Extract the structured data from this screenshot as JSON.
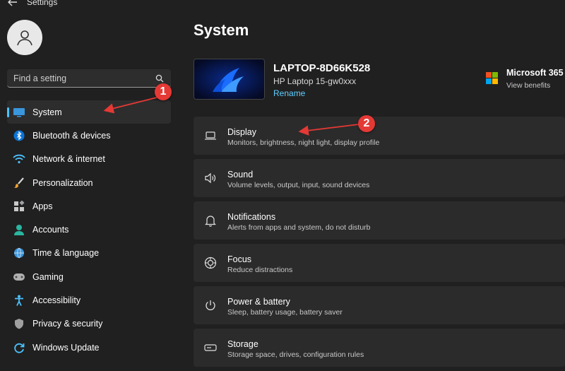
{
  "app": {
    "title": "Settings"
  },
  "search": {
    "placeholder": "Find a setting"
  },
  "sidebar": {
    "items": [
      {
        "label": "System",
        "icon": "monitor-icon",
        "selected": true
      },
      {
        "label": "Bluetooth & devices",
        "icon": "bluetooth-icon"
      },
      {
        "label": "Network & internet",
        "icon": "wifi-icon"
      },
      {
        "label": "Personalization",
        "icon": "brush-icon"
      },
      {
        "label": "Apps",
        "icon": "apps-icon"
      },
      {
        "label": "Accounts",
        "icon": "person-icon"
      },
      {
        "label": "Time & language",
        "icon": "globe-clock-icon"
      },
      {
        "label": "Gaming",
        "icon": "gamepad-icon"
      },
      {
        "label": "Accessibility",
        "icon": "accessibility-icon"
      },
      {
        "label": "Privacy & security",
        "icon": "shield-icon"
      },
      {
        "label": "Windows Update",
        "icon": "update-icon"
      }
    ]
  },
  "main": {
    "title": "System",
    "device": {
      "name": "LAPTOP-8D66K528",
      "model": "HP Laptop 15-gw0xxx",
      "rename_label": "Rename"
    },
    "microsoft365": {
      "title": "Microsoft 365",
      "subtitle": "View benefits"
    },
    "cards": [
      {
        "title": "Display",
        "subtitle": "Monitors, brightness, night light, display profile",
        "icon": "laptop-icon"
      },
      {
        "title": "Sound",
        "subtitle": "Volume levels, output, input, sound devices",
        "icon": "speaker-icon"
      },
      {
        "title": "Notifications",
        "subtitle": "Alerts from apps and system, do not disturb",
        "icon": "bell-icon"
      },
      {
        "title": "Focus",
        "subtitle": "Reduce distractions",
        "icon": "focus-icon"
      },
      {
        "title": "Power & battery",
        "subtitle": "Sleep, battery usage, battery saver",
        "icon": "power-icon"
      },
      {
        "title": "Storage",
        "subtitle": "Storage space, drives, configuration rules",
        "icon": "storage-icon"
      }
    ]
  },
  "annotations": {
    "callout_1": "1",
    "callout_2": "2"
  },
  "colors": {
    "accent": "#4cc2ff",
    "link": "#60cdff",
    "callout": "#e53935",
    "background": "#202020",
    "card": "#2b2b2b"
  }
}
